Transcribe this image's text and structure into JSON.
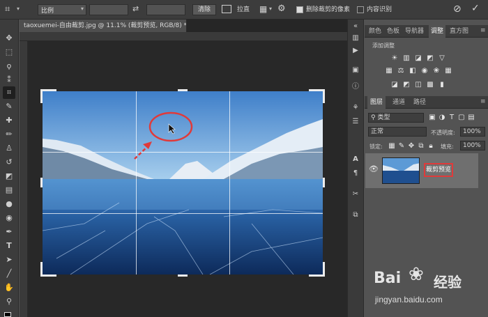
{
  "options_bar": {
    "ratio_label": "比例",
    "clear_label": "清除",
    "straighten_label": "拉直",
    "delete_cropped_label": "删除裁剪的像素",
    "content_aware_label": "内容识别",
    "delete_cropped_checked": true,
    "content_aware_checked": false
  },
  "document": {
    "tab_title": "taoxuemei-自由裁剪.jpg @ 11.1% (裁剪预览, RGB/8) *",
    "close_glyph": "×"
  },
  "panels": {
    "top_tabs": [
      "颜色",
      "色板",
      "导航器",
      "调整",
      "直方图"
    ],
    "active_top_tab": "调整",
    "adjustments_title": "添加调整",
    "layer_tabs": [
      "图层",
      "通道",
      "路径"
    ],
    "active_layer_tab": "图层",
    "filter_label": "类型",
    "blend_mode": "正常",
    "opacity_label": "不透明度:",
    "opacity_value": "100%",
    "lock_label": "锁定:",
    "fill_label": "填充:",
    "fill_value": "100%",
    "layer_name": "裁剪预览"
  },
  "watermark": {
    "brand": "Bai",
    "brand2": "经验",
    "url": "jingyan.baidu.com"
  },
  "colors": {
    "annotation_red": "#e03a3a",
    "panel_bg": "#535353",
    "toolbar_bg": "#3c3c3c",
    "canvas_bg": "#282828"
  }
}
